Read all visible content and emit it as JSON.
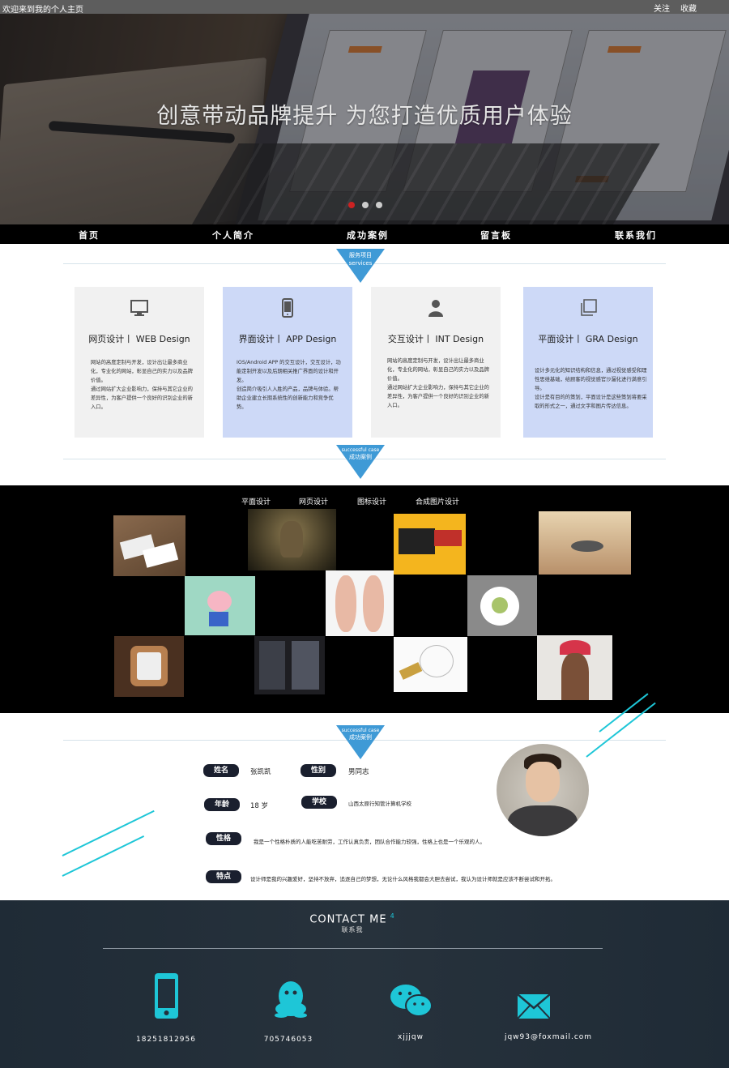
{
  "topbar": {
    "welcome": "欢迎来到我的个人主页",
    "follow": "关注",
    "favorite": "收藏"
  },
  "hero": {
    "title": "创意带动品牌提升  为您打造优质用户体验",
    "slides_total": 3,
    "slide_active": 1,
    "colors": {
      "active": "#cc2222",
      "inactive": "#cccccc"
    }
  },
  "nav": {
    "items": [
      "首页",
      "个人简介",
      "成功案例",
      "留言板",
      "联系我们"
    ]
  },
  "services": {
    "badge_cn": "服务项目",
    "badge_en": "services",
    "badge_color": "#3f9ad6",
    "cards": [
      {
        "icon": "monitor-icon",
        "title": "网页设计丨 WEB Design",
        "body": "网站的高度定制与开发，设计出让最多商业化，专业化的网站，彰显自己的实力以及品牌价值。\n通过网站扩大企业影响力，保持与其它企业的差异性，为客户提供一个良好的识别企业的新入口。",
        "bg": "#f1f1f1"
      },
      {
        "icon": "phone-icon",
        "title": "界面设计丨 APP Design",
        "body": "IOS/Android APP 的交互设计，交互设计，功能定制开发以及后期相关推广界面的设计和开发。\n创造简介吸引人入胜的产品，品牌与体验。帮助企业建立长期系统性的创新能力和竞争优势。",
        "bg": "#cdd9f7"
      },
      {
        "icon": "user-icon",
        "title": "交互设计丨 INT Design",
        "body": "网站的高度定制与开发，设计出让最多商业化，专业化的网站，彰显自己的实力以及品牌价值。\n通过网站扩大企业影响力，保持与其它企业的差异性，为客户提供一个良好的识别企业的新入口。",
        "bg": "#f1f1f1"
      },
      {
        "icon": "copy-icon",
        "title": "平面设计丨 GRA Design",
        "body": "设计多元化的知识结构和信息，通过视觉感受和理性思维基础，给顾客的视觉感官沙漏化进行满意引导。\n设计是有目的的策划，平面设计是这些策划将要采取的形式之一，通过文字和图片传达信息。",
        "bg": "#cdd9f7"
      }
    ]
  },
  "cases": {
    "badge_en": "successful case",
    "badge_cn": "成功案例",
    "tabs": [
      "平面设计",
      "网页设计",
      "图标设计",
      "合成图片设计"
    ]
  },
  "profile": {
    "badge_en": "successful case",
    "badge_cn": "成功案例",
    "name_label": "姓名",
    "name": "张凯凯",
    "gender_label": "性别",
    "gender": "男同志",
    "age_label": "年龄",
    "age": "18 岁",
    "school_label": "学校",
    "school": "山西太原行知管计算机学校",
    "personality_label": "性格",
    "personality": "我是一个性格朴质的人能吃苦耐劳，工作认真负责，团队合作能力较强，性格上也是一个乐观的人。",
    "traits_label": "特点",
    "traits": "设计师是我的兴趣爱好，坚持不放弃，追逐自己的梦想，无论什么风格我都会大胆去尝试，我认为设计师就是应该不断尝试和开拓。"
  },
  "contact": {
    "title": "CONTACT ME",
    "sup": "4",
    "subtitle": "联系我",
    "items": [
      {
        "icon": "phone-icon",
        "value": "18251812956"
      },
      {
        "icon": "qq-icon",
        "value": "705746053"
      },
      {
        "icon": "wechat-icon",
        "value": "xjjjqw"
      },
      {
        "icon": "mail-icon",
        "value": "jqw93@foxmail.com"
      }
    ],
    "accent": "#1ec6d7"
  }
}
